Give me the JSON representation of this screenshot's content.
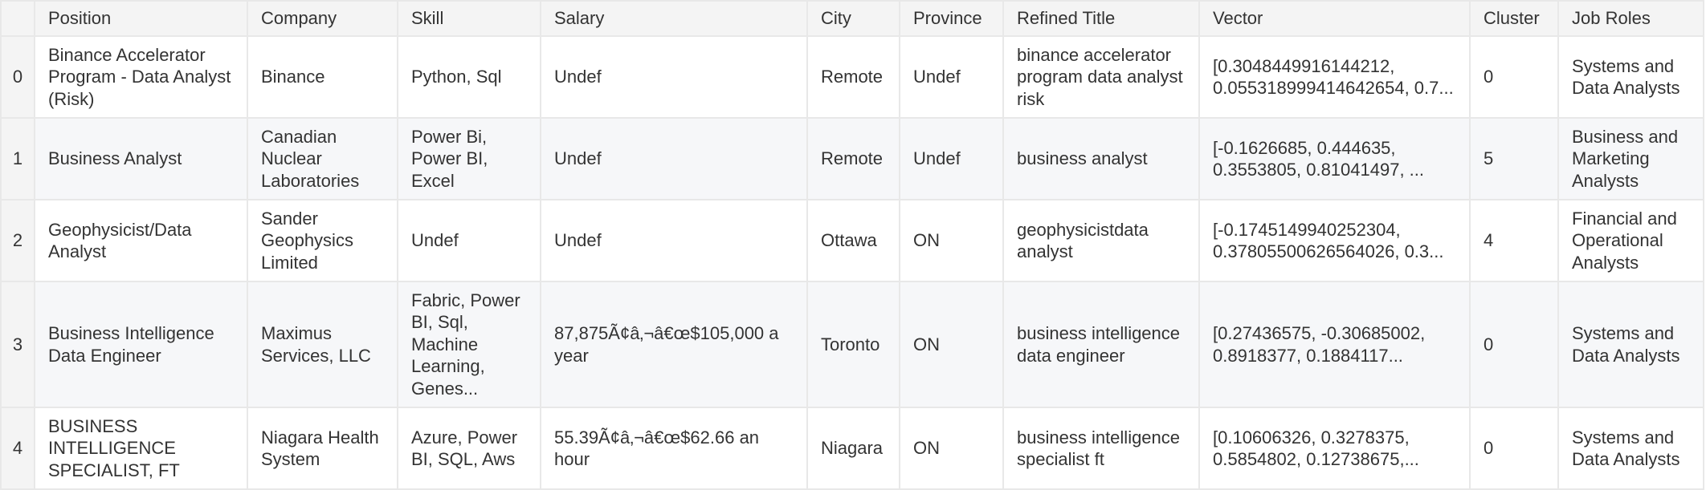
{
  "table": {
    "columns": [
      "",
      "Position",
      "Company",
      "Skill",
      "Salary",
      "City",
      "Province",
      "Refined Title",
      "Vector",
      "Cluster",
      "Job Roles"
    ],
    "rows": [
      {
        "index": "0",
        "position": "Binance Accelerator Program - Data Analyst (Risk)",
        "company": "Binance",
        "skill": "Python, Sql",
        "salary": "Undef",
        "city": "Remote",
        "province": "Undef",
        "refined_title": "binance accelerator program data analyst risk",
        "vector": "[0.3048449916144212, 0.055318999414642654, 0.7...",
        "cluster": "0",
        "job_roles": "Systems and Data Analysts"
      },
      {
        "index": "1",
        "position": "Business Analyst",
        "company": "Canadian Nuclear Laboratories",
        "skill": "Power Bi, Power BI, Excel",
        "salary": "Undef",
        "city": "Remote",
        "province": "Undef",
        "refined_title": "business analyst",
        "vector": "[-0.1626685, 0.444635, 0.3553805, 0.81041497, ...",
        "cluster": "5",
        "job_roles": "Business and Marketing Analysts"
      },
      {
        "index": "2",
        "position": "Geophysicist/Data Analyst",
        "company": "Sander Geophysics Limited",
        "skill": "Undef",
        "salary": "Undef",
        "city": "Ottawa",
        "province": "ON",
        "refined_title": "geophysicistdata analyst",
        "vector": "[-0.1745149940252304, 0.37805500626564026, 0.3...",
        "cluster": "4",
        "job_roles": "Financial and Operational Analysts"
      },
      {
        "index": "3",
        "position": "Business Intelligence Data Engineer",
        "company": "Maximus Services, LLC",
        "skill": "Fabric, Power BI, Sql, Machine Learning, Genes...",
        "salary": "87,875Ã¢â‚¬â€œ$105,000 a year",
        "city": "Toronto",
        "province": "ON",
        "refined_title": "business intelligence data engineer",
        "vector": "[0.27436575, -0.30685002, 0.8918377, 0.1884117...",
        "cluster": "0",
        "job_roles": "Systems and Data Analysts"
      },
      {
        "index": "4",
        "position": "BUSINESS INTELLIGENCE SPECIALIST, FT",
        "company": "Niagara Health System",
        "skill": "Azure, Power BI, SQL, Aws",
        "salary": "55.39Ã¢â‚¬â€œ$62.66 an hour",
        "city": "Niagara",
        "province": "ON",
        "refined_title": "business intelligence specialist ft",
        "vector": "[0.10606326, 0.3278375, 0.5854802, 0.12738675,...",
        "cluster": "0",
        "job_roles": "Systems and Data Analysts"
      }
    ]
  },
  "colors": {
    "header_bg": "#f4f4f4",
    "stripe_bg": "#f6f7f9",
    "border": "#e8e8e8",
    "text": "#333333"
  }
}
